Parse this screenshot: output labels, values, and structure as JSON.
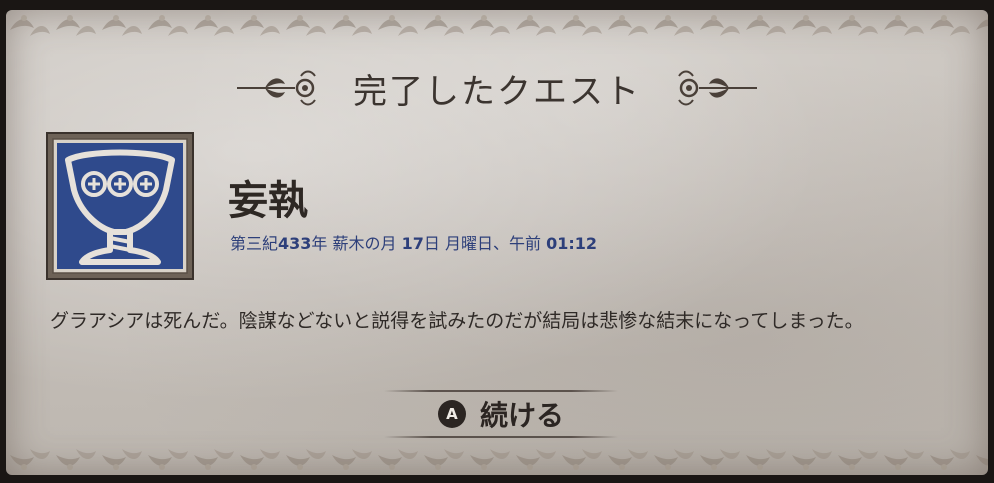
{
  "header": {
    "title": "完了したクエスト"
  },
  "quest": {
    "icon": "chalice-icon",
    "name": "妄執",
    "date_prefix": "第三紀",
    "era_year": "433",
    "year_suffix": "年 薪木の月 ",
    "day": "17",
    "day_suffix": "日 月曜日、午前 ",
    "time": "01:12",
    "description": "グラアシアは死んだ。陰謀などないと説得を試みたのだが結局は悲惨な結末になってしまった。"
  },
  "continue_button": {
    "key": "A",
    "label": "続ける"
  },
  "colors": {
    "parchment": "#c9c3bd",
    "title_text": "#3b342f",
    "date_text": "#2d3f7a",
    "icon_blue": "#2f4a8c",
    "icon_frame": "#8a7c6e"
  }
}
